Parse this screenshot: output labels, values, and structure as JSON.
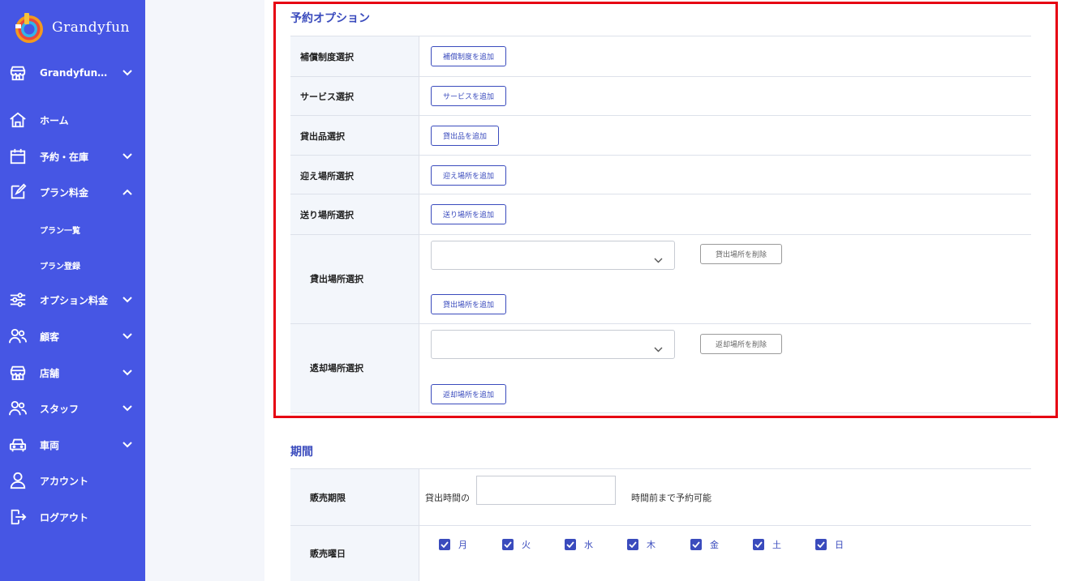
{
  "brand": {
    "name": "Grandyfun"
  },
  "sidebar": {
    "store": "Grandyfun…",
    "home": "ホーム",
    "reservation": "予約・在庫",
    "plan_price": "プラン料金",
    "plan_list": "プラン一覧",
    "plan_register": "プラン登録",
    "option_price": "オプション料金",
    "customer": "顧客",
    "shop": "店舗",
    "staff": "スタッフ",
    "vehicle": "車両",
    "account": "アカウント",
    "logout": "ログアウト"
  },
  "reservation_options": {
    "title": "予約オプション",
    "rows": {
      "compensation": {
        "label": "補償制度選択",
        "button": "補償制度を追加"
      },
      "service": {
        "label": "サービス選択",
        "button": "サービスを追加"
      },
      "rental_item": {
        "label": "貸出品選択",
        "button": "貸出品を追加"
      },
      "pickup": {
        "label": "迎え場所選択",
        "button": "迎え場所を追加"
      },
      "dropoff": {
        "label": "送り場所選択",
        "button": "送り場所を追加"
      },
      "rental_place": {
        "label": "貸出場所選択",
        "required": "*",
        "select_value": "",
        "delete_button": "貸出場所を削除",
        "add_button": "貸出場所を追加"
      },
      "return_place": {
        "label": "返却場所選択",
        "required": "*",
        "select_value": "",
        "delete_button": "返却場所を削除",
        "add_button": "返却場所を追加"
      }
    }
  },
  "period": {
    "title": "期間",
    "sales_limit": {
      "label": "販売期限",
      "required": "*",
      "prefix": "貸出時間の",
      "value": "",
      "suffix": "時間前まで予約可能"
    },
    "sales_days": {
      "label": "販売曜日",
      "required": "*",
      "days": [
        "月",
        "火",
        "水",
        "木",
        "金",
        "土",
        "日"
      ],
      "checked": [
        true,
        true,
        true,
        true,
        true,
        true,
        true
      ]
    }
  },
  "colors": {
    "sidebar": "#4656e4",
    "accent": "#3a4bbd",
    "required": "#e02020",
    "highlight": "#e60012"
  }
}
